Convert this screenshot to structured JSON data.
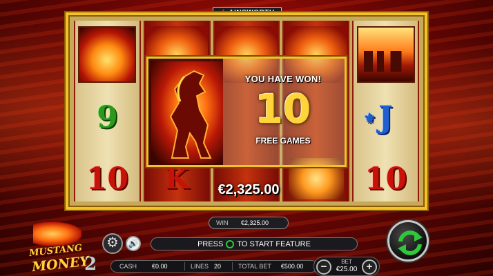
{
  "brand": {
    "name": "AINSWORTH"
  },
  "reels": {
    "reel1": {
      "top": "fire-gold-bars",
      "middle": "9",
      "bottom": "10"
    },
    "reel2": {
      "top": "fire-horse",
      "bottom": "K"
    },
    "reel3": {
      "top": "fire-horse"
    },
    "reel4": {
      "top": "fire-horse",
      "bottom": "eagle"
    },
    "reel5": {
      "top": "desert-sunset",
      "middle": "J",
      "bottom": "10"
    }
  },
  "popup": {
    "headline": "YOU HAVE WON!",
    "count": "10",
    "label": "FREE GAMES"
  },
  "total_win": "€2,325.00",
  "win_box": {
    "label": "WIN",
    "value": "€2,325.00"
  },
  "prompt": {
    "before": "PRESS",
    "after": "TO START FEATURE"
  },
  "info": {
    "cash_label": "CASH",
    "cash_value": "€0.00",
    "lines_label": "LINES",
    "lines_value": "20",
    "total_bet_label": "TOTAL BET",
    "total_bet_value": "€500.00"
  },
  "bet": {
    "label": "BET",
    "value": "€25.00",
    "minus": "−",
    "plus": "+"
  },
  "logo": {
    "word1": "MUSTANG",
    "word2": "MONEY",
    "number": "2"
  },
  "icons": {
    "settings": "gear-icon",
    "sound": "speaker-icon",
    "spin": "spin-arrows-icon"
  },
  "colors": {
    "frame_gold": "#f3c228",
    "spin_green": "#2ec93a",
    "background_red": "#b01008"
  }
}
